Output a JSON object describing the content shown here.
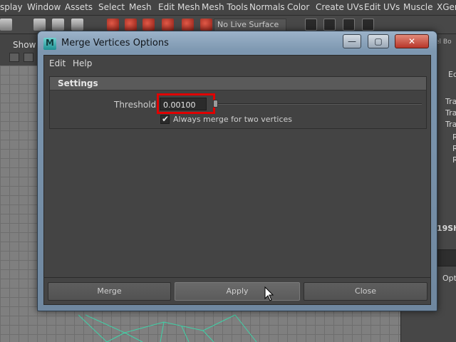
{
  "menubar": {
    "items": [
      "splay",
      "Window",
      "Assets",
      "Select",
      "Mesh",
      "Edit Mesh",
      "Mesh Tools",
      "Normals",
      "Color",
      "Create UVs",
      "Edit UVs",
      "Muscle",
      "XGen"
    ]
  },
  "shelf": {
    "live_surface": "No Live Surface"
  },
  "panel": {
    "show_label": "Show"
  },
  "right_panel": {
    "top_text": "el Bo",
    "ed_text": "Ed",
    "rows": [
      "Tra",
      "Tra",
      "Tra",
      "R",
      "R",
      "R"
    ],
    "shape_text": "19Sh",
    "opti_text": "Opti"
  },
  "dialog": {
    "title": "Merge Vertices Options",
    "icon_letter": "M",
    "minimize_glyph": "—",
    "maximize_glyph": "▢",
    "close_glyph": "✕",
    "menu": {
      "edit": "Edit",
      "help": "Help"
    },
    "settings": {
      "header": "Settings",
      "threshold_label": "Threshold:",
      "threshold_value": "0.00100",
      "slider_position": 0.0,
      "always_merge_label": "Always merge for two vertices",
      "always_merge_checked": true,
      "check_glyph": "✔"
    },
    "buttons": {
      "merge": "Merge",
      "apply": "Apply",
      "close": "Close"
    }
  },
  "colors": {
    "highlight_box": "#e00000",
    "viewport_wire": "#3fd3a8",
    "title_bar": "#7d97b0"
  }
}
